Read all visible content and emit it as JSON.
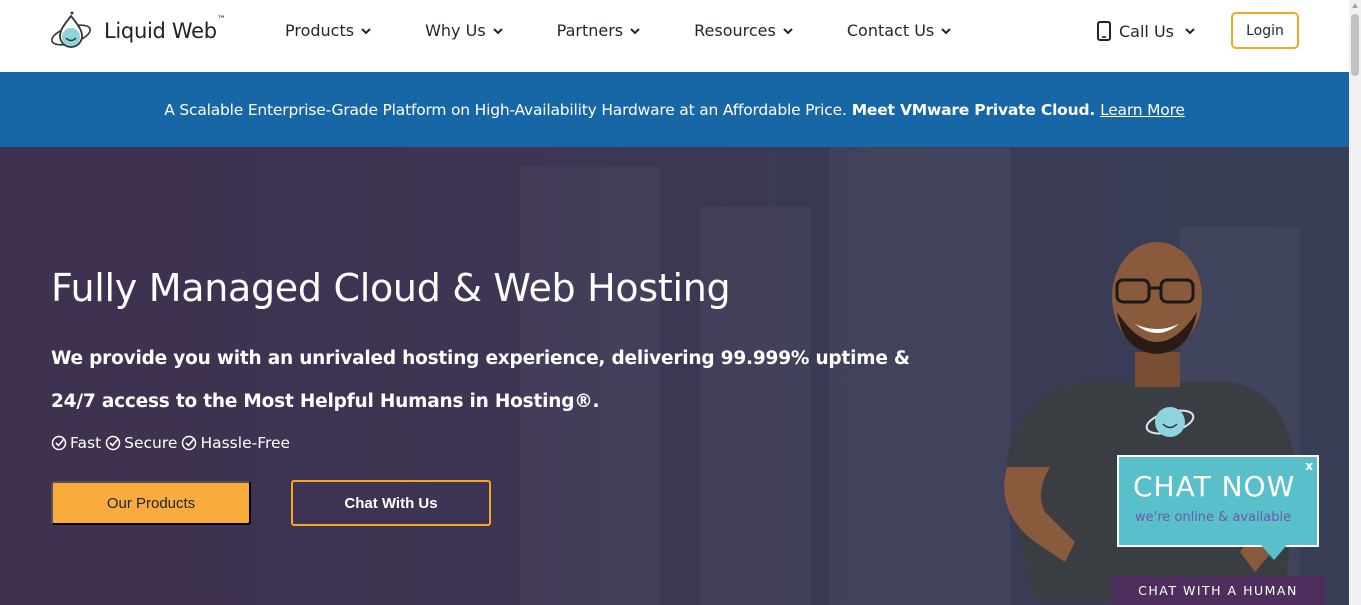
{
  "brand": {
    "name": "Liquid Web",
    "trademark": "™"
  },
  "nav": {
    "items": [
      {
        "label": "Products"
      },
      {
        "label": "Why Us"
      },
      {
        "label": "Partners"
      },
      {
        "label": "Resources"
      },
      {
        "label": "Contact Us"
      }
    ],
    "call_label": "Call Us",
    "login_label": "Login"
  },
  "banner": {
    "text": "A Scalable Enterprise-Grade Platform on High-Availability Hardware at an Affordable Price.",
    "highlight": "Meet VMware Private Cloud.",
    "link": "Learn More"
  },
  "hero": {
    "title": "Fully Managed Cloud & Web Hosting",
    "subtitle": "We provide you with an unrivaled hosting experience, delivering 99.999% uptime & 24/7 access to the Most Helpful Humans in Hosting®.",
    "features": [
      "Fast",
      "Secure",
      "Hassle-Free"
    ],
    "primary_button": "Our Products",
    "secondary_button": "Chat With Us"
  },
  "chat_widget": {
    "title": "CHAT NOW",
    "subtitle": "we're online & available",
    "close": "x",
    "human_button": "CHAT WITH A HUMAN"
  },
  "colors": {
    "accent": "#f9ac3d",
    "banner": "#1766a5",
    "hero_bg": "#3e3453",
    "chat_teal": "#59c0cb",
    "chat_human_bg": "#4d2e5c"
  }
}
